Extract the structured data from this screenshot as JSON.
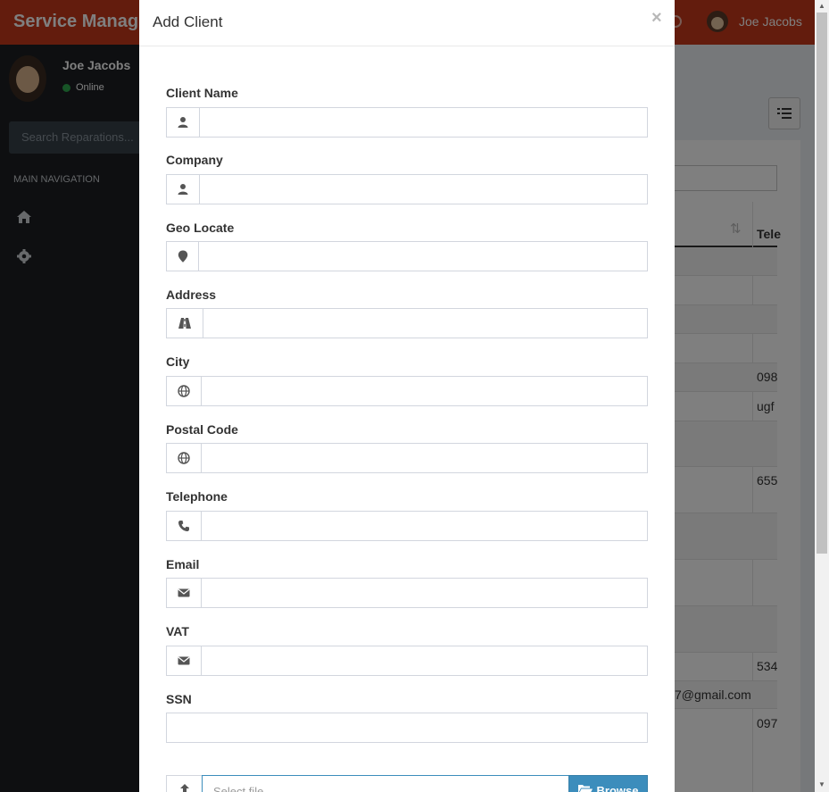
{
  "app": {
    "brand": "Service Manag",
    "user_name": "Joe Jacobs",
    "user_status": "Online",
    "search_placeholder": "Search Reparations...",
    "nav_header": "MAIN NAVIGATION"
  },
  "background_table": {
    "header_label": "Tele",
    "cells": [
      "098",
      "ugf",
      "655",
      "534",
      "7@gmail.com",
      "097"
    ]
  },
  "modal": {
    "title": "Add Client",
    "close": "×",
    "fields": [
      {
        "label": "Client Name",
        "icon": "user-icon",
        "value": ""
      },
      {
        "label": "Company",
        "icon": "user-icon",
        "value": ""
      },
      {
        "label": "Geo Locate",
        "icon": "map-marker-icon",
        "value": ""
      },
      {
        "label": "Address",
        "icon": "road-icon",
        "value": ""
      },
      {
        "label": "City",
        "icon": "globe-icon",
        "value": ""
      },
      {
        "label": "Postal Code",
        "icon": "globe-icon",
        "value": ""
      },
      {
        "label": "Telephone",
        "icon": "phone-icon",
        "value": ""
      },
      {
        "label": "Email",
        "icon": "envelope-icon",
        "value": ""
      },
      {
        "label": "VAT",
        "icon": "envelope-icon",
        "value": ""
      },
      {
        "label": "SSN",
        "icon": "",
        "value": ""
      }
    ],
    "file": {
      "placeholder": "Select file...",
      "browse_label": "Browse"
    }
  },
  "colors": {
    "topbar": "#c7391a",
    "sidebar": "#1c1f22",
    "browse_button": "#3c8dbc"
  }
}
